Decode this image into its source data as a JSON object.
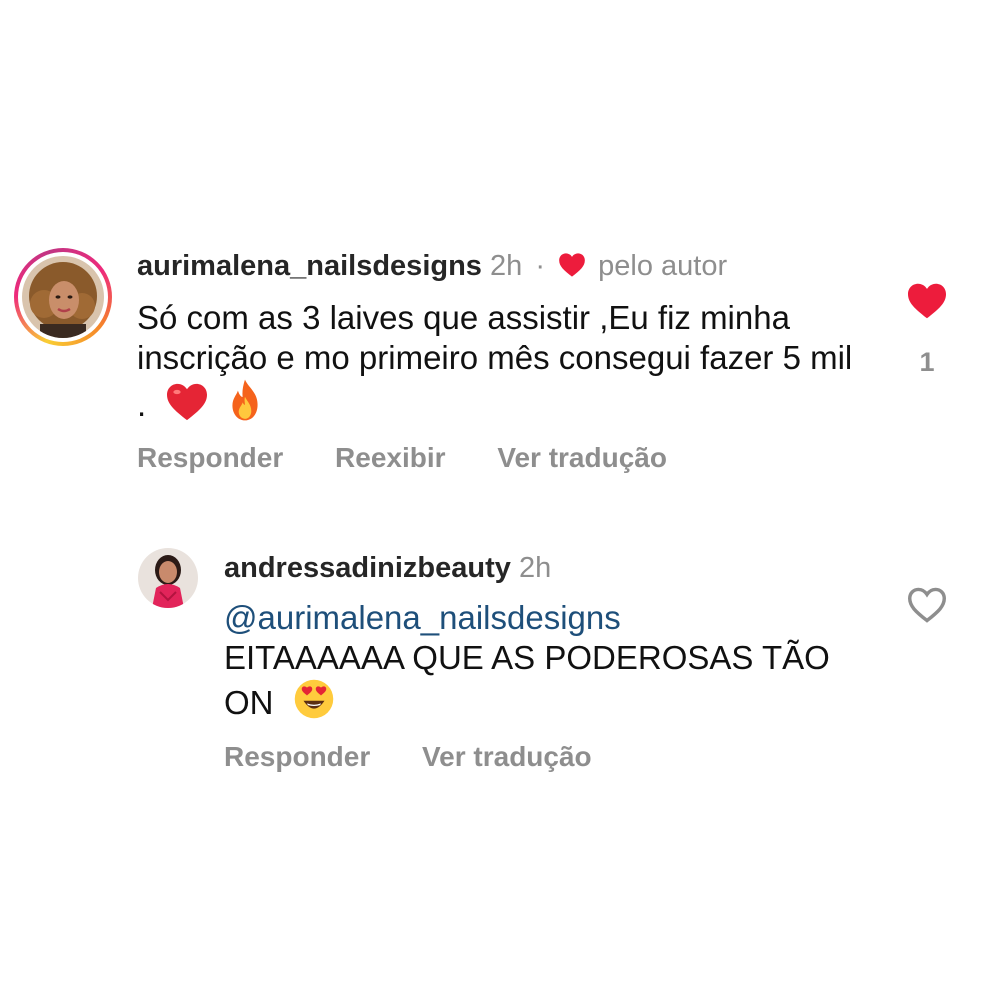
{
  "comments": [
    {
      "username": "aurimalena_nailsdesigns",
      "time": "2h",
      "separator": "·",
      "liked_by_author_label": "pelo autor",
      "text": "Só com as 3 laives que assistir ,Eu fiz minha inscrição e mo primeiro mês consegui fazer 5 mil .",
      "emojis": [
        "red-heart-emoji",
        "fire-emoji"
      ],
      "actions": [
        "Responder",
        "Reexibir",
        "Ver tradução"
      ],
      "liked": true,
      "like_count": "1",
      "colors": {
        "like": "#ed1c3c",
        "story_ring": "#ee2a7b"
      }
    },
    {
      "username": "andressadinizbeauty",
      "time": "2h",
      "mention": "@aurimalena_nailsdesigns",
      "text": "EITAAAAAA QUE AS PODEROSAS TÃO ON",
      "emojis": [
        "heart-eyes-emoji"
      ],
      "actions": [
        "Responder",
        "Ver tradução"
      ],
      "liked": false,
      "colors": {
        "mention": "#1e4f7a"
      }
    }
  ]
}
